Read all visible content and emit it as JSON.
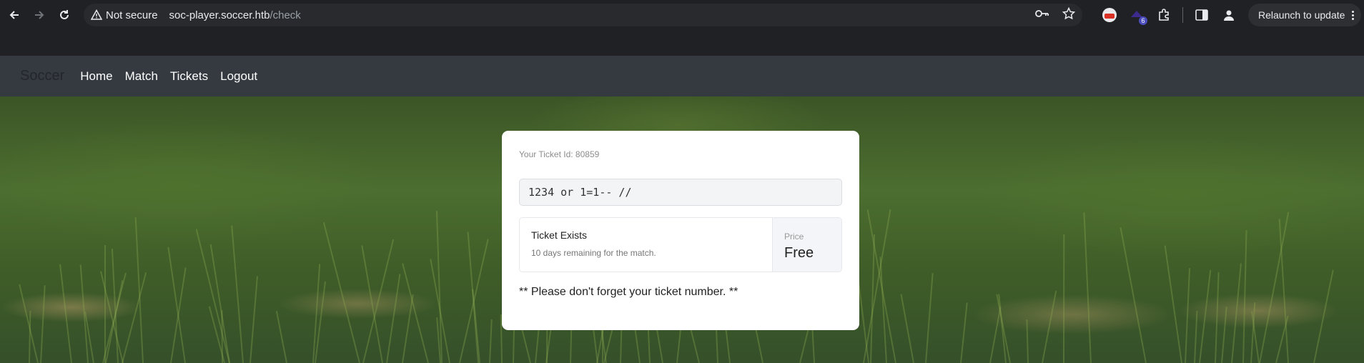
{
  "browser": {
    "security_label": "Not secure",
    "url_host": "soc-player.soccer.htb",
    "url_path": "/check",
    "relaunch_label": "Relaunch to update",
    "extension_badge": "6"
  },
  "site": {
    "brand": "Soccer",
    "nav": [
      {
        "label": "Home"
      },
      {
        "label": "Match"
      },
      {
        "label": "Tickets"
      },
      {
        "label": "Logout"
      }
    ]
  },
  "ticket": {
    "id_text": "Your Ticket Id: 80859",
    "input_value": "1234 or 1=1-- //",
    "result_title": "Ticket Exists",
    "result_subtitle": "10 days remaining for the match.",
    "price_label": "Price",
    "price_value": "Free",
    "note": "** Please don't forget your ticket number. **"
  }
}
